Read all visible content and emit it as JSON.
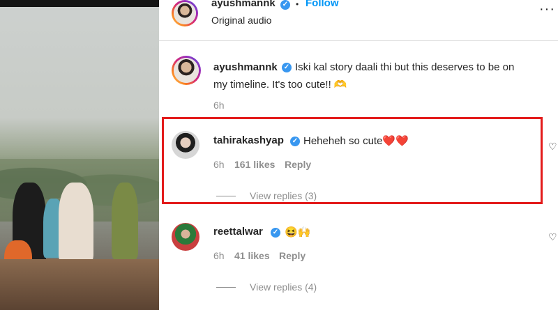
{
  "post": {
    "username": "ayushmannk",
    "follow_label": "Follow",
    "separator": "•",
    "audio_label": "Original audio",
    "more_icon": "more-horizontal-icon"
  },
  "comments": [
    {
      "username": "ayushmannk",
      "text_line1": "Iski kal story daali thi but this deserves to be on",
      "text_line2": "my timeline. It's too cute!! 🫶",
      "time": "6h",
      "likes": "",
      "reply_label": "",
      "view_replies": ""
    },
    {
      "username": "tahirakashyap",
      "text_line1": "Heheheh so cute❤️❤️",
      "time": "6h",
      "likes": "161 likes",
      "reply_label": "Reply",
      "view_replies": "View replies (3)"
    },
    {
      "username": "reettalwar",
      "text_line1": "😆🙌",
      "time": "6h",
      "likes": "41 likes",
      "reply_label": "Reply",
      "view_replies": "View replies (4)"
    }
  ],
  "colors": {
    "highlight": "#e31b1b",
    "link": "#0095f6",
    "verified": "#3897f0",
    "muted": "#8e8e8e"
  }
}
